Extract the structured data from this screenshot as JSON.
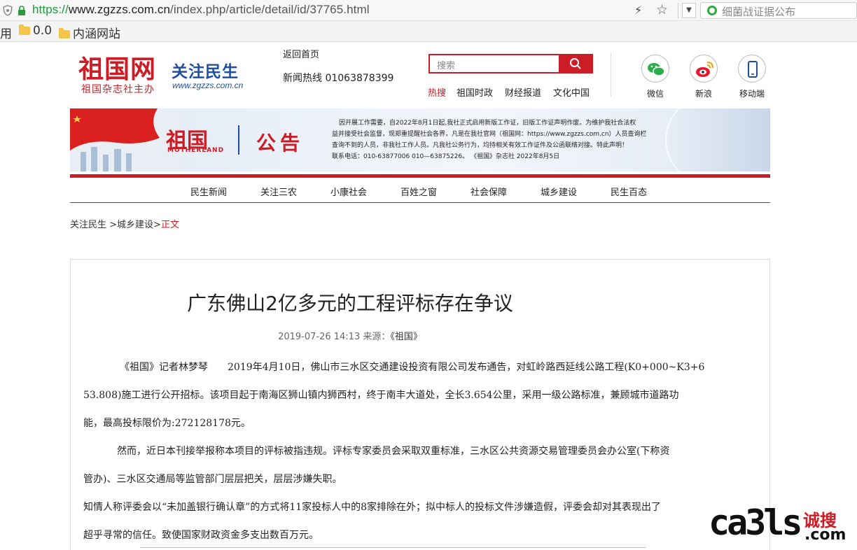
{
  "browser": {
    "url_scheme": "https://",
    "url_host": "www.zgzzs.com.cn",
    "url_path": "/index.php/article/detail/id/37765.html",
    "search_text": "细菌战证据公布",
    "bookmarks": [
      "用",
      "0.0",
      "内涵网站"
    ]
  },
  "header": {
    "logo_cn": "祖国网",
    "logo_sub": "祖国杂志社主办",
    "logo_slogan": "关注民生",
    "logo_url": "www.zgzzs.com.cn",
    "home_link": "返回首页",
    "hotline": "新闻热线 01063878399",
    "search_placeholder": "搜索",
    "hot_label": "热搜",
    "hot_links": [
      "祖国时政",
      "财经报道",
      "文化中国"
    ],
    "social": [
      "微信",
      "新浪",
      "移动端"
    ]
  },
  "banner": {
    "brand": "祖国",
    "brand_en": "MOTHERLAND",
    "title": "公告",
    "notice_lines": [
      "因开展工作需要，自2022年8月1日起,我社正式启用新版工作证，旧版工作证声明作废。为维护我社合法权",
      "益并接受社会监督，现郑重提醒社会各界，凡是在我社官网（祖国网：https://www.zgzzs.com.cn）人员查询栏",
      "查询不到的人员，非我社工作人员。凡我社公务行为，均持相关有效工作证件及公函联络对接。特此声明！",
      "联系电话：010-63877006    010—63875226。      《祖国》杂志社    2022年8月5日"
    ]
  },
  "nav": [
    "民生新闻",
    "关注三农",
    "小康社会",
    "百姓之窗",
    "社会保障",
    "城乡建设",
    "民生百态"
  ],
  "breadcrumb": {
    "part1": "关注民生 >",
    "part2": "城乡建设>",
    "current": "正文"
  },
  "article": {
    "title": "广东佛山2亿多元的工程评标存在争议",
    "date": "2019-07-26 14:13",
    "source_label": "来源：",
    "source": "《祖国》",
    "paragraphs": [
      "《祖国》记者林梦琴　　2019年4月10日，佛山市三水区交通建设投资有限公司发布通告，对虹岭路西延线公路工程(K0+000~K3+6",
      "53.808)施工进行公开招标。该项目起于南海区狮山镇内狮西村，终于南丰大道处，全长3.654公里，采用一级公路标准，兼顾城市道路功",
      "能，最高投标限价为:272128178元。",
      "然而，近日本刊接举报称本项目的评标被指违规。评标专家委员会采取双重标准，三水区公共资源交易管理委员会办公室(下称资",
      "管办)、三水区交通局等监管部门层层把关，层层涉嫌失职。",
      "知情人称评委会以“未加盖银行确认章”的方式将11家投标人中的8家排除在外；拟中标人的投标文件涉嫌造假，评委会却对其表现出了",
      "超乎寻常的信任。致使国家财政资金多支出数百万元。"
    ]
  },
  "watermark": {
    "brand": "ca3ls",
    "cn": "诚搜",
    "domain": ".com"
  },
  "colors": {
    "brand_red": "#cc1d26",
    "brand_blue": "#1f4fa3"
  }
}
